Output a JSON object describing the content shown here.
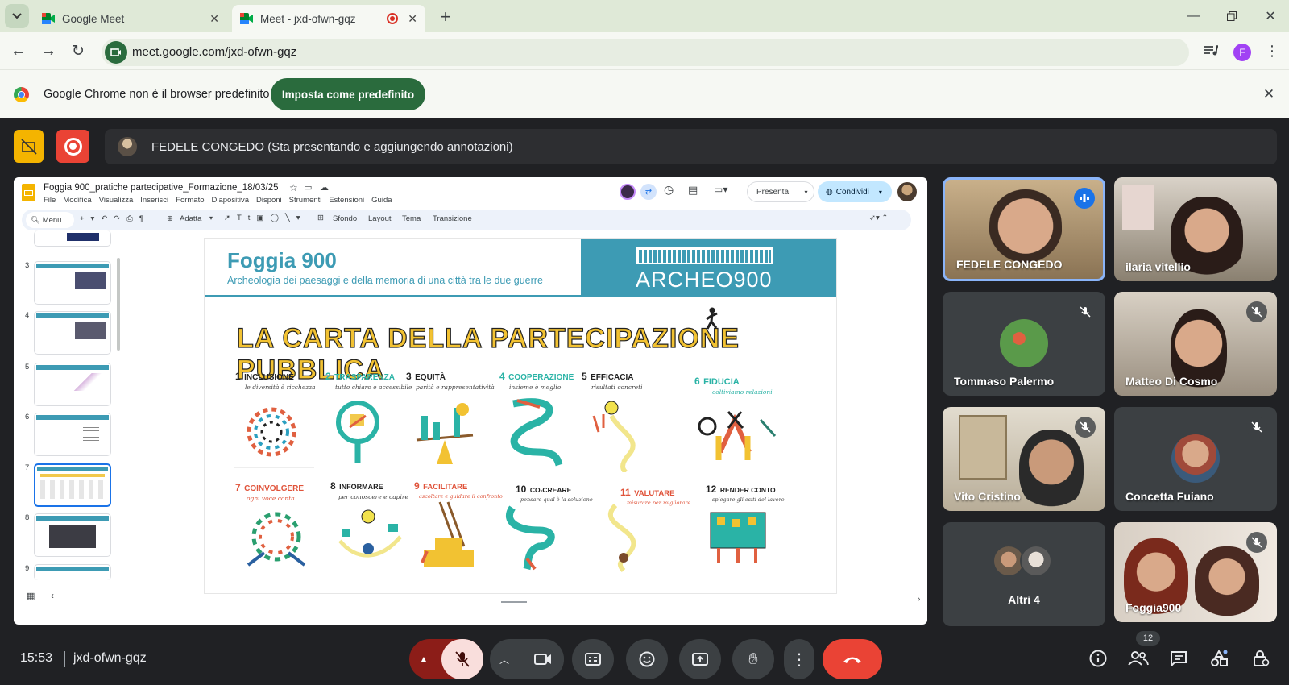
{
  "browser": {
    "tabs": [
      {
        "title": "Google Meet"
      },
      {
        "title": "Meet - jxd-ofwn-gqz"
      }
    ],
    "url": "meet.google.com/jxd-ofwn-gqz",
    "profile_initial": "F",
    "infobar": {
      "message": "Google Chrome non è il browser predefinito",
      "button": "Imposta come predefinito"
    }
  },
  "meet": {
    "presenter_banner": "FEDELE CONGEDO (Sta presentando e aggiungendo annotazioni)",
    "time": "15:53",
    "meeting_code": "jxd-ofwn-gqz",
    "participants_count": "12",
    "participants": [
      {
        "name": "FEDELE CONGEDO"
      },
      {
        "name": "ilaria vitellio"
      },
      {
        "name": "Tommaso Palermo"
      },
      {
        "name": "Matteo Di Cosmo"
      },
      {
        "name": "Vito Cristino"
      },
      {
        "name": "Concetta Fuiano"
      },
      {
        "name": "Altri 4"
      },
      {
        "name": "Foggia900"
      }
    ],
    "colors": {
      "background": "#202124",
      "hangup": "#ea4335",
      "mic_off": "#f9dedc",
      "active_border": "#8ab4f8"
    }
  },
  "slides_app": {
    "doc_title": "Foggia 900_pratiche partecipative_Formazione_18/03/25",
    "menu": [
      "File",
      "Modifica",
      "Visualizza",
      "Inserisci",
      "Formato",
      "Diapositiva",
      "Disponi",
      "Strumenti",
      "Estensioni",
      "Guida"
    ],
    "toolbar": {
      "search": "Menu",
      "zoom": "Adatta",
      "background": "Sfondo",
      "layout": "Layout",
      "theme": "Tema",
      "transition": "Transizione"
    },
    "present": "Presenta",
    "share": "Condividi",
    "thumb_numbers": [
      "3",
      "4",
      "5",
      "6",
      "7",
      "8",
      "9"
    ],
    "slide": {
      "title": "Foggia 900",
      "subtitle": "Archeologia dei paesaggi e della memoria di una città tra le due guerre",
      "logo": "ARCHEO900",
      "heading": "LA CARTA DELLA PARTECIPAZIONE PUBBLICA",
      "principles": [
        {
          "num": "1",
          "name": "INCLUSIONE",
          "sub": "le diversità è ricchezza"
        },
        {
          "num": "2",
          "name": "TRASPARENZA",
          "sub": "tutto chiaro e accessibile"
        },
        {
          "num": "3",
          "name": "EQUITÀ",
          "sub": "parità e rappresentatività"
        },
        {
          "num": "4",
          "name": "COOPERAZIONE",
          "sub": "insieme è meglio"
        },
        {
          "num": "5",
          "name": "EFFICACIA",
          "sub": "risultati concreti"
        },
        {
          "num": "6",
          "name": "FIDUCIA",
          "sub": "coltiviamo relazioni"
        },
        {
          "num": "7",
          "name": "COINVOLGERE",
          "sub": "ogni voce conta"
        },
        {
          "num": "8",
          "name": "INFORMARE",
          "sub": "per conoscere e capire"
        },
        {
          "num": "9",
          "name": "FACILITARE",
          "sub": "ascoltare e guidare il confronto"
        },
        {
          "num": "10",
          "name": "CO-CREARE",
          "sub": "pensare qual è la soluzione"
        },
        {
          "num": "11",
          "name": "VALUTARE",
          "sub": "misurare per migliorare"
        },
        {
          "num": "12",
          "name": "RENDER CONTO",
          "sub": "spiegare gli esiti del lavoro"
        }
      ]
    }
  }
}
